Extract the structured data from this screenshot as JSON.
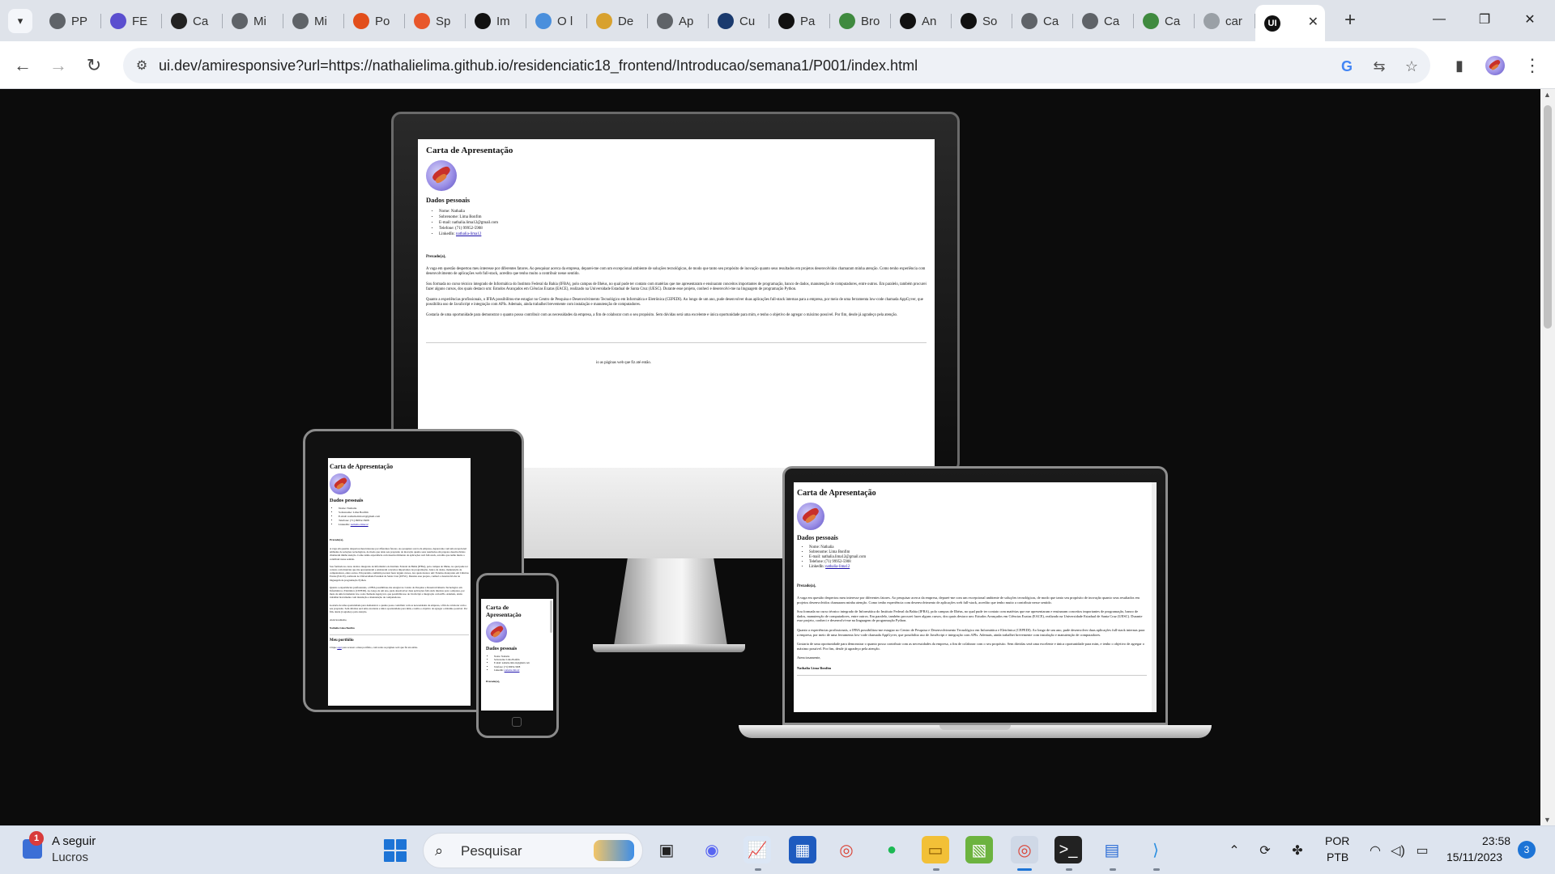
{
  "browser": {
    "tabs": [
      {
        "title": "PP",
        "icon": "globe-icon",
        "color": "#5f6368"
      },
      {
        "title": "FE",
        "icon": "globe-icon",
        "color": "#5b4fcf"
      },
      {
        "title": "Ca",
        "icon": "g-logo-icon",
        "color": "#222222"
      },
      {
        "title": "Mi",
        "icon": "globe-icon",
        "color": "#5f6368"
      },
      {
        "title": "Mi",
        "icon": "globe-icon",
        "color": "#5f6368"
      },
      {
        "title": "Po",
        "icon": "figma-icon",
        "color": "#e24e1b"
      },
      {
        "title": "Sp",
        "icon": "flame-icon",
        "color": "#e8572b"
      },
      {
        "title": "Im",
        "icon": "a-logo-icon",
        "color": "#111111"
      },
      {
        "title": "O l",
        "icon": "flower-icon",
        "color": "#4a8fdc"
      },
      {
        "title": "De",
        "icon": "book-icon",
        "color": "#d8a12e"
      },
      {
        "title": "Ap",
        "icon": "globe-icon",
        "color": "#5f6368"
      },
      {
        "title": "Cu",
        "icon": "mit-icon",
        "color": "#1a3a6e"
      },
      {
        "title": "Pa",
        "icon": "github-icon",
        "color": "#111111"
      },
      {
        "title": "Bro",
        "icon": "chart-icon",
        "color": "#3f8a3f"
      },
      {
        "title": "An",
        "icon": "ui-logo-icon",
        "color": "#111111"
      },
      {
        "title": "So",
        "icon": "github-icon",
        "color": "#111111"
      },
      {
        "title": "Ca",
        "icon": "globe-icon",
        "color": "#5f6368"
      },
      {
        "title": "Ca",
        "icon": "globe-icon",
        "color": "#5f6368"
      },
      {
        "title": "Ca",
        "icon": "chart-icon",
        "color": "#3f8a3f"
      },
      {
        "title": "car",
        "icon": "globe-icon",
        "color": "#9aa0a6"
      }
    ],
    "active_tab_icon": "UI",
    "close_glyph": "✕",
    "url": "ui.dev/amiresponsive?url=https://nathalielima.github.io/residenciatic18_frontend/Introducao/semana1/P001/index.html"
  },
  "page": {
    "title": "Carta de Apresentação",
    "section_personal": "Dados pessoais",
    "personal": [
      "Nome: Nathalia",
      "Sobrenome: Lima Bonfim",
      "E-mail: nathalia.lima12@gmail.com",
      "Telefone: (71) 99952-5908"
    ],
    "linkedin_label": "LinkedIn:",
    "linkedin_link": "nathalia-lima12",
    "greeting": "Prezado(a),",
    "para1": "A vaga em questão despertou meu interesse por diferentes fatores. Ao pesquisar acerca da empresa, deparei-me com um excepcional ambiente de soluções tecnológicas, de modo que tanto seu propósito de inovação quanto seus resultados em projetos desenvolvidos chamaram minha atenção. Como tenho experiência com desenvolvimento de aplicações web full-stack, acredito que tenho muito a contribuir nesse sentido.",
    "para2": "Sou formada no curso técnico integrado de Informática do Instituto Federal da Bahia (IFBA), polo campus de Ilhéus, no qual pude ter contato com matérias que me apresentaram e ensinaram conceitos importantes de programação, banco de dados, manutenção de computadores, entre outros. Em paralelo, também procurei fazer alguns cursos, dos quais destaco um: Estudos Avançados em Ciências Exatas (EACE), realizado na Universidade Estadual de Santa Cruz (UESC). Durante esse projeto, conheci e desenvolvi-me na linguagem de programação Python.",
    "para3": "Quanto a experiências profissionais, o IFBA possibilitou-me estagiar no Centro de Pesquisa e Desenvolvimento Tecnológico em Informática e Eletrônica (CEPEDI). Ao longo de um ano, pude desenvolver duas aplicações full-stack internas para a empresa, por meio de uma ferramenta low-code chamada AppGyver, que possibilita uso de JavaScript e integração com APIs. Ademais, ainda trabalhei brevemente com instalação e manutenção de computadores.",
    "para4": "Gostaria de uma oportunidade para demonstrar o quanto posso contribuir com as necessidades da empresa, a fim de colaborar com o seu propósito. Sem dúvidas será uma excelente e única oportunidade para mim, e tenho o objetivo de agregar o máximo possível. Por fim, desde já agradeço pela atenção.",
    "closing": "Atenciosamente,",
    "signature": "Nathalia Lima Bonfim",
    "section_portfolio": "Meu portfólio",
    "portfolio_text_before": "Clique",
    "portfolio_link": "aqui",
    "portfolio_text_after": "para acessar o meu portfólio, com todas as páginas web que fiz até então.",
    "imac_fragment": "io as páginas web que fiz até então."
  },
  "taskbar": {
    "weather_badge": "1",
    "weather_title": "A seguir",
    "weather_sub": "Lucros",
    "search_label": "Pesquisar",
    "lang_top": "POR",
    "lang_bottom": "PTB",
    "time": "23:58",
    "date": "15/11/2023",
    "notifications": "3"
  }
}
